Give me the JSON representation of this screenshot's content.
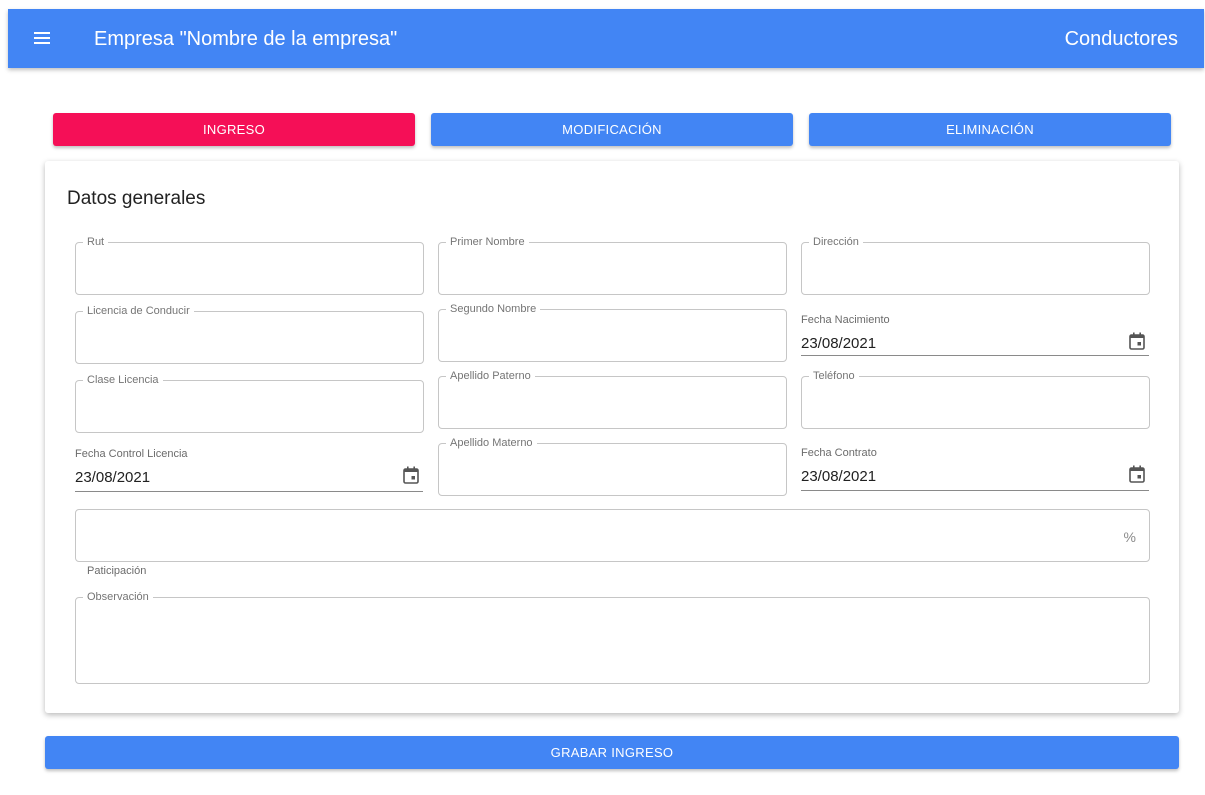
{
  "appbar": {
    "title": "Empresa \"Nombre de la empresa\"",
    "section": "Conductores",
    "color": "#4285f4",
    "menu_icon": "hamburger-menu-icon"
  },
  "tabs": {
    "ingreso": "INGRESO",
    "modificacion": "MODIFICACIÓN",
    "eliminacion": "ELIMINACIÓN",
    "active_color": "#f50f57"
  },
  "form": {
    "title": "Datos generales",
    "rut": {
      "label": "Rut",
      "value": ""
    },
    "primer_nombre": {
      "label": "Primer Nombre",
      "value": ""
    },
    "direccion": {
      "label": "Dirección",
      "value": ""
    },
    "licencia": {
      "label": "Licencia de Conducir",
      "value": ""
    },
    "segundo_nombre": {
      "label": "Segundo Nombre",
      "value": ""
    },
    "fecha_nacimiento": {
      "label": "Fecha Nacimiento",
      "value": "23/08/2021"
    },
    "clase_licencia": {
      "label": "Clase Licencia",
      "value": ""
    },
    "apellido_paterno": {
      "label": "Apellido Paterno",
      "value": ""
    },
    "telefono": {
      "label": "Teléfono",
      "value": ""
    },
    "fecha_control": {
      "label": "Fecha Control Licencia",
      "value": "23/08/2021"
    },
    "apellido_materno": {
      "label": "Apellido Materno",
      "value": ""
    },
    "fecha_contrato": {
      "label": "Fecha Contrato",
      "value": "23/08/2021"
    },
    "participacion": {
      "helper": "Paticipación",
      "suffix": "%",
      "value": ""
    },
    "observacion": {
      "label": "Observación",
      "value": ""
    }
  },
  "actions": {
    "save": "GRABAR INGRESO"
  }
}
